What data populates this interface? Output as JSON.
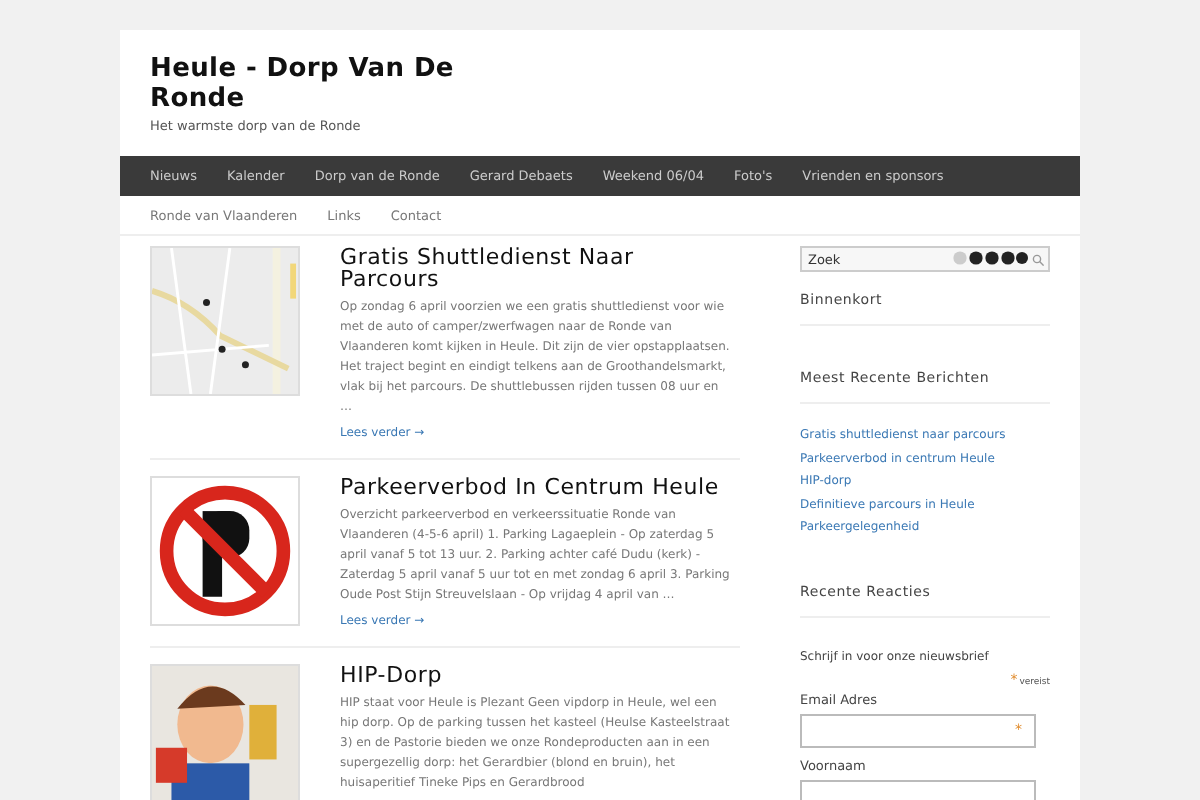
{
  "site": {
    "title": "Heule - Dorp Van De Ronde",
    "tagline": "Het warmste dorp van de Ronde"
  },
  "nav": [
    {
      "label": "Nieuws"
    },
    {
      "label": "Kalender"
    },
    {
      "label": "Dorp van de Ronde"
    },
    {
      "label": "Gerard Debaets"
    },
    {
      "label": "Weekend 06/04"
    },
    {
      "label": "Foto's"
    },
    {
      "label": "Vrienden en sponsors"
    }
  ],
  "subnav": [
    {
      "label": "Ronde van Vlaanderen"
    },
    {
      "label": "Links"
    },
    {
      "label": "Contact"
    }
  ],
  "posts": [
    {
      "kind": "map",
      "title": "Gratis Shuttledienst Naar Parcours",
      "excerpt": "Op zondag 6 april voorzien we een gratis shuttledienst voor wie met de auto of camper/zwerfwagen naar de Ronde van Vlaanderen komt kijken in Heule. Dit zijn de vier opstapplaatsen. Het traject begint en eindigt telkens aan de Groothandelsmarkt, vlak bij het parcours. De shuttlebussen rijden tussen 08 uur en …",
      "more": "Lees verder →"
    },
    {
      "kind": "sign",
      "title": "Parkeerverbod In Centrum Heule",
      "excerpt": "Overzicht parkeerverbod en verkeerssituatie Ronde van Vlaanderen (4-5-6 april) 1. Parking Lagaeplein - Op zaterdag 5 april vanaf 5 tot 13 uur. 2. Parking achter café Dudu (kerk) - Zaterdag 5 april vanaf 5 uur tot en met zondag 6 april 3. Parking Oude Post Stijn Streuvelslaan - Op vrijdag 4 april van …",
      "more": "Lees verder →"
    },
    {
      "kind": "figure",
      "title": "HIP-Dorp",
      "excerpt": "HIP staat voor Heule is Plezant Geen vipdorp in Heule, wel een hip dorp. Op de parking tussen het kasteel (Heulse Kasteelstraat 3) en de Pastorie bieden we onze Rondeproducten aan in een supergezellig dorp: het Gerardbier (blond en bruin), het huisaperitief Tineke Pips en Gerardbrood"
    }
  ],
  "sidebar": {
    "search": {
      "placeholder": "Zoek"
    },
    "widgets": [
      {
        "title": "Binnenkort"
      },
      {
        "title": "Meest Recente Berichten",
        "links": [
          "Gratis shuttledienst naar parcours",
          "Parkeerverbod in centrum Heule",
          "HIP-dorp",
          "Definitieve parcours in Heule",
          "Parkeergelegenheid"
        ]
      },
      {
        "title": "Recente Reacties"
      }
    ],
    "newsletter": {
      "title": "Schrijf in voor onze nieuwsbrief",
      "required_mark": "*",
      "required_label": "vereist",
      "fields": [
        {
          "label": "Email Adres",
          "required": true
        },
        {
          "label": "Voornaam",
          "required": false
        }
      ]
    }
  }
}
